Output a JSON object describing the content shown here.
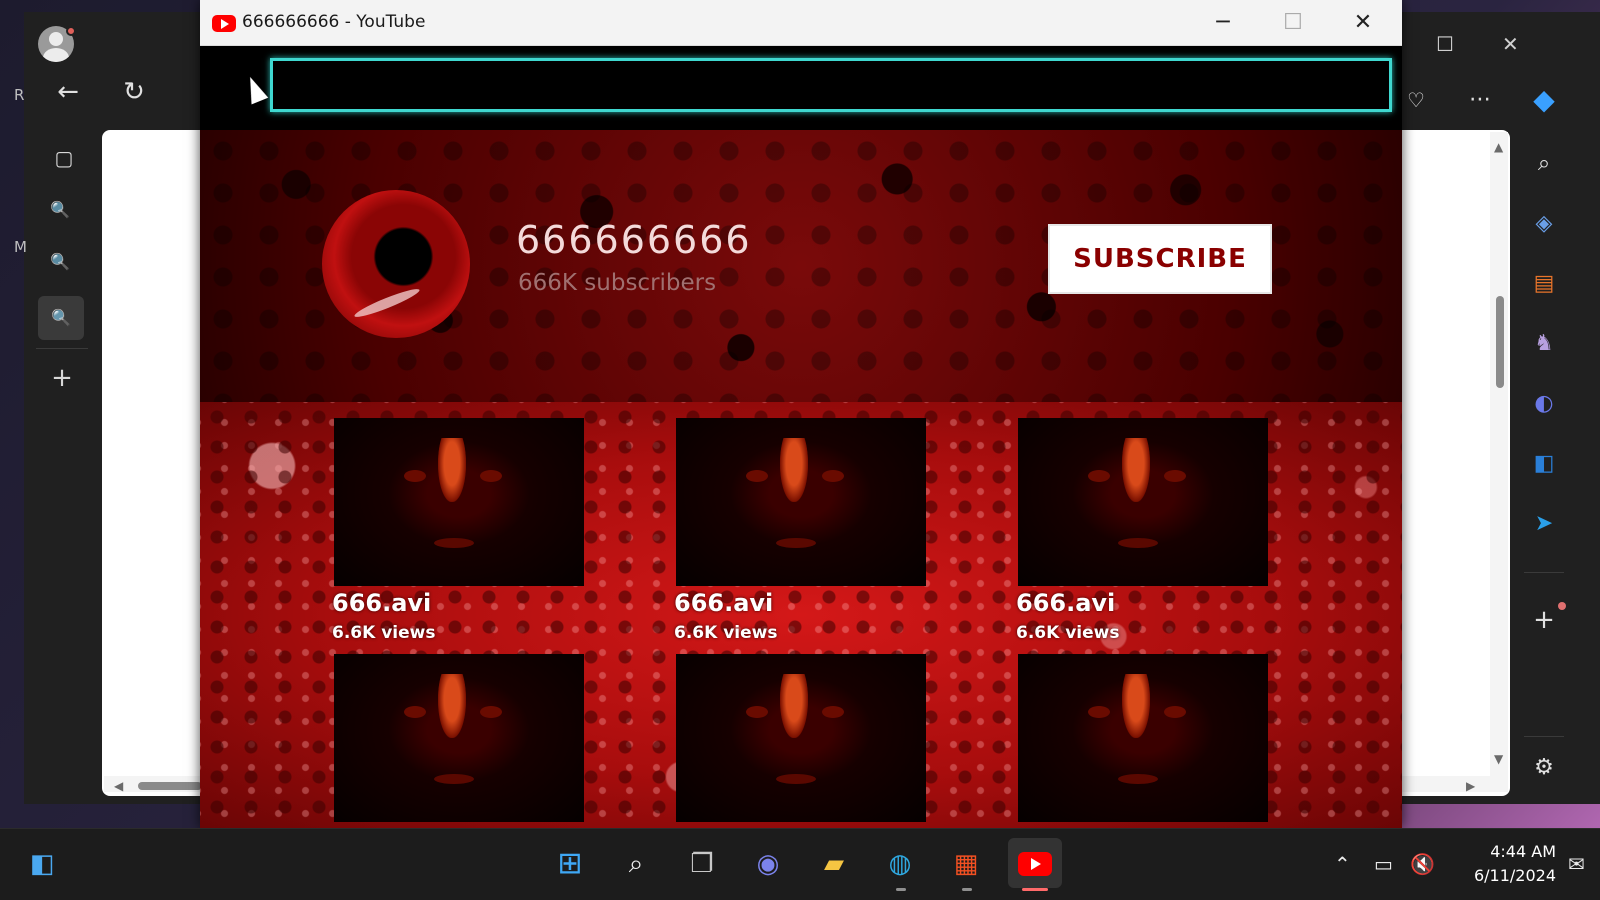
{
  "window": {
    "title": "666666666 - YouTube",
    "minimize_glyph": "─",
    "maximize_glyph": "☐",
    "close_glyph": "✕"
  },
  "channel": {
    "name": "666666666",
    "subscribers": "666K subscribers",
    "subscribe_label": "SUBSCRIBE"
  },
  "videos": [
    {
      "title": "666.avi",
      "views": "6.6K views"
    },
    {
      "title": "666.avi",
      "views": "6.6K views"
    },
    {
      "title": "666.avi",
      "views": "6.6K views"
    },
    {
      "title": "",
      "views": ""
    },
    {
      "title": "",
      "views": ""
    },
    {
      "title": "",
      "views": ""
    }
  ],
  "background_browser": {
    "left_letters": [
      "R",
      "M"
    ],
    "sidebar_icons": [
      "search-icon",
      "tag-icon",
      "briefcase-icon",
      "chess-icon",
      "copilot-designer-icon",
      "outlook-icon",
      "send-icon",
      "add-icon",
      "settings-icon"
    ]
  },
  "taskbar": {
    "time": "4:44 AM",
    "date": "6/11/2024",
    "apps": [
      "widgets",
      "start",
      "search",
      "task-view",
      "chat",
      "file-explorer",
      "edge",
      "store",
      "youtube"
    ]
  },
  "colors": {
    "accent_search_border": "#3fd8d0",
    "subscribe_text": "#8a0000",
    "youtube_red": "#ff0000"
  }
}
